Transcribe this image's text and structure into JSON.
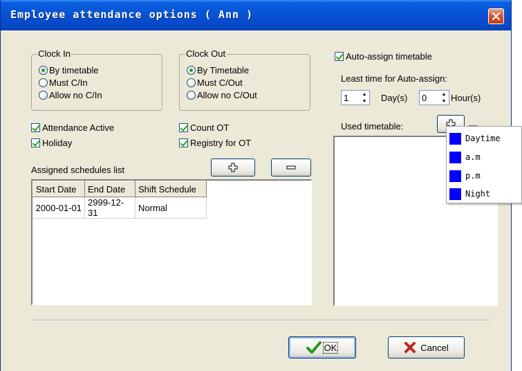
{
  "window": {
    "title": "Employee attendance options ( Ann )"
  },
  "colors": {
    "accent": "#0851d3",
    "check_green": "#21a121",
    "timetable_swatch": "#0000ff"
  },
  "clock_in": {
    "label": "Clock In",
    "options": [
      "By timetable",
      "Must C/In",
      "Allow no C/In"
    ],
    "selected": 0
  },
  "clock_out": {
    "label": "Clock Out",
    "options": [
      "By Timetable",
      "Must C/Out",
      "Allow no C/Out"
    ],
    "selected": 0
  },
  "checks": {
    "attendance_active": {
      "label": "Attendance Active",
      "checked": true
    },
    "holiday": {
      "label": "Holiday",
      "checked": true
    },
    "count_ot": {
      "label": "Count OT",
      "checked": true
    },
    "registry_ot": {
      "label": "Registry for OT",
      "checked": true
    }
  },
  "schedules": {
    "label": "Assigned schedules list",
    "add_icon": "plus-icon",
    "remove_icon": "minus-icon",
    "columns": [
      "Start Date",
      "End Date",
      "Shift Schedule"
    ],
    "rows": [
      [
        "2000-01-01",
        "2999-12-31",
        "Normal"
      ]
    ]
  },
  "auto_assign": {
    "label": "Auto-assign timetable",
    "checked": true,
    "least_time_label": "Least time for Auto-assign:",
    "days_value": "1",
    "days_unit": "Day(s)",
    "hours_value": "0",
    "hours_unit": "Hour(s)"
  },
  "used_timetable": {
    "label": "Used timetable:",
    "dropdown_items": [
      "Daytime",
      "a.m",
      "p.m",
      "Night"
    ]
  },
  "buttons": {
    "ok": "OK",
    "cancel": "Cancel"
  }
}
